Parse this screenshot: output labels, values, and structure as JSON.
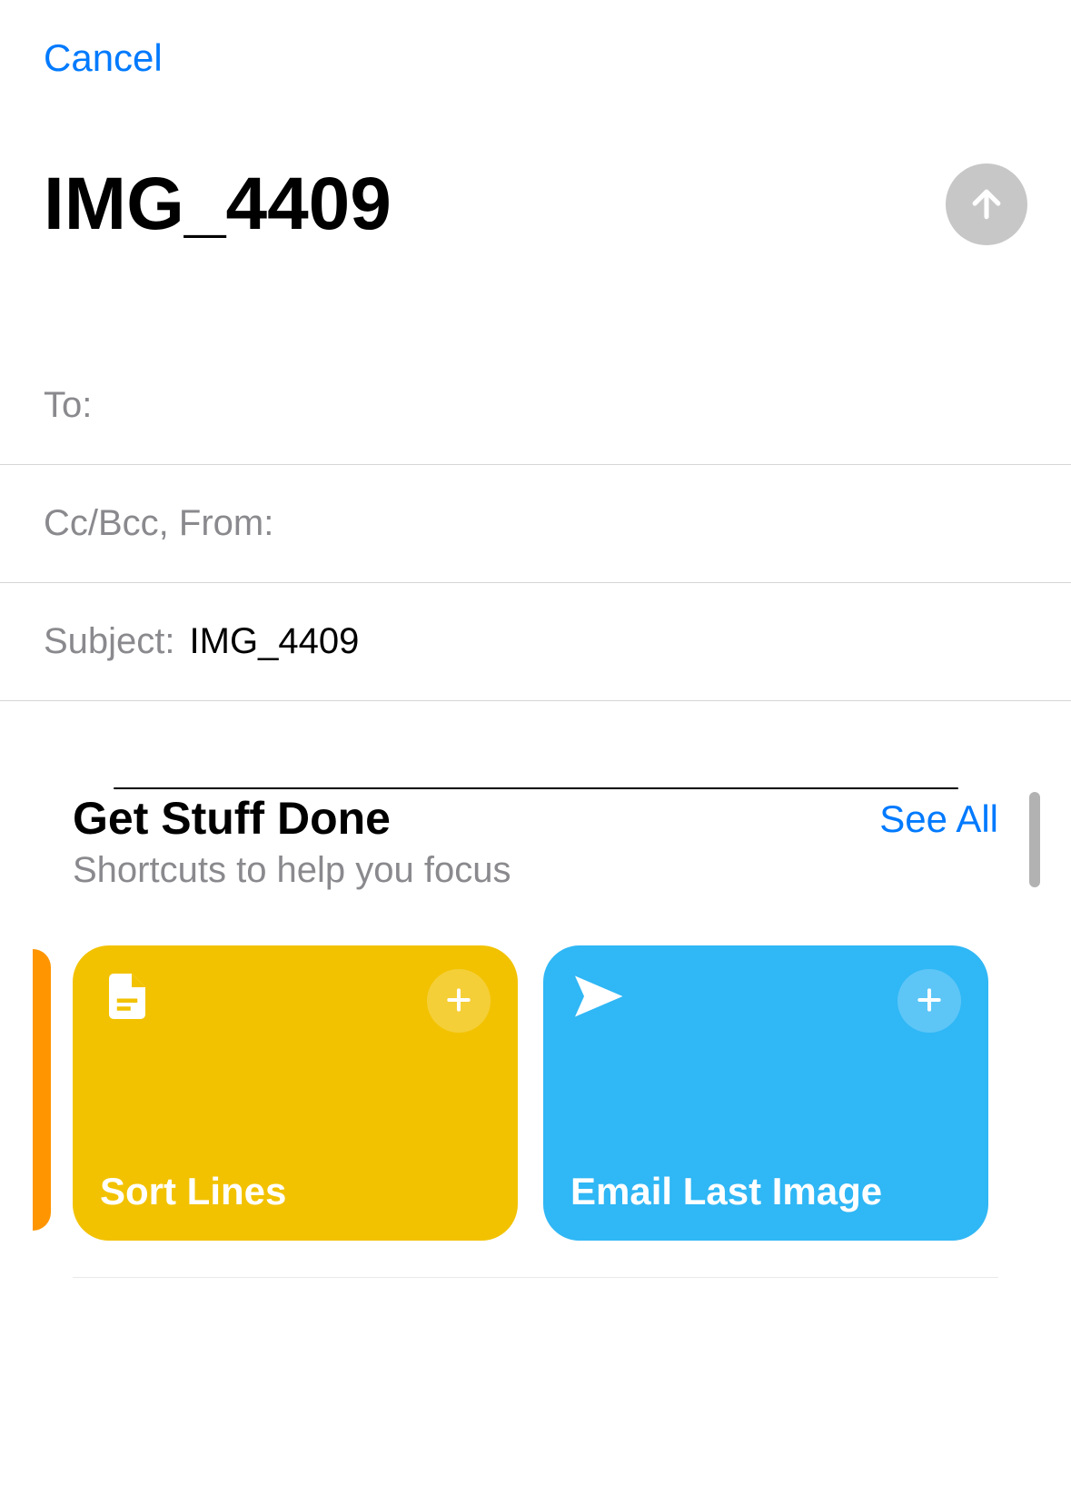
{
  "header": {
    "cancel_label": "Cancel",
    "title": "IMG_4409"
  },
  "fields": {
    "to_label": "To:",
    "to_value": "",
    "ccbcc_label": "Cc/Bcc, From:",
    "ccbcc_value": "",
    "subject_label": "Subject:",
    "subject_value": "IMG_4409"
  },
  "shortcuts": {
    "section_title": "Get Stuff Done",
    "section_subtitle": "Shortcuts to help you focus",
    "see_all_label": "See All",
    "cards": [
      {
        "label": "Sort Lines",
        "icon": "document-icon",
        "color": "yellow"
      },
      {
        "label": "Email Last Image",
        "icon": "send-icon",
        "color": "blue"
      }
    ]
  },
  "colors": {
    "system_blue": "#007aff",
    "shortcut_yellow": "#f2c200",
    "shortcut_blue": "#30b7f5",
    "prev_orange": "#ff9500",
    "label_gray": "#8a8a8e"
  }
}
